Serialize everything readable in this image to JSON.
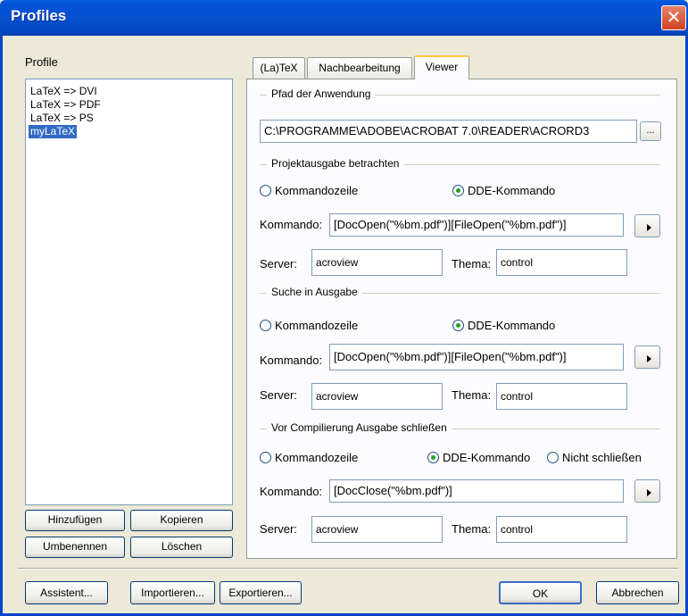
{
  "window": {
    "title": "Profiles",
    "close_glyph": "✕"
  },
  "profiles": {
    "label": "Profile",
    "items": [
      "LaTeX => DVI",
      "LaTeX => PDF",
      "LaTeX => PS",
      "myLaTeX"
    ],
    "selected": "myLaTeX",
    "buttons": {
      "add": "Hinzufügen",
      "copy": "Kopieren",
      "rename": "Umbenennen",
      "delete": "Löschen"
    }
  },
  "tabs": [
    "(La)TeX",
    "Nachbearbeitung",
    "Viewer"
  ],
  "active_tab": "Viewer",
  "viewer": {
    "app_path": {
      "title": "Pfad der Anwendung",
      "value": "C:\\PROGRAMME\\ADOBE\\ACROBAT 7.0\\READER\\ACRORD3",
      "browse_label": "..."
    },
    "view_output": {
      "title": "Projektausgabe betrachten",
      "options": [
        "Kommandozeile",
        "DDE-Kommando"
      ],
      "selected": "DDE-Kommando",
      "command_label": "Kommando:",
      "command_value": "[DocOpen(\"%bm.pdf\")][FileOpen(\"%bm.pdf\")]",
      "server_label": "Server:",
      "server_value": "acroview",
      "topic_label": "Thema:",
      "topic_value": "control"
    },
    "search_output": {
      "title": "Suche in Ausgabe",
      "options": [
        "Kommandozeile",
        "DDE-Kommando"
      ],
      "selected": "DDE-Kommando",
      "command_label": "Kommando:",
      "command_value": "[DocOpen(\"%bm.pdf\")][FileOpen(\"%bm.pdf\")]",
      "server_label": "Server:",
      "server_value": "acroview",
      "topic_label": "Thema:",
      "topic_value": "control"
    },
    "close_before_compile": {
      "title": "Vor Compilierung Ausgabe schließen",
      "options": [
        "Kommandozeile",
        "DDE-Kommando",
        "Nicht schließen"
      ],
      "selected": "DDE-Kommando",
      "command_label": "Kommando:",
      "command_value": "[DocClose(\"%bm.pdf\")]",
      "server_label": "Server:",
      "server_value": "acroview",
      "topic_label": "Thema:",
      "topic_value": "control"
    }
  },
  "footer": {
    "wizard": "Assistent...",
    "import": "Importieren...",
    "export": "Exportieren...",
    "ok": "OK",
    "cancel": "Abbrechen"
  }
}
